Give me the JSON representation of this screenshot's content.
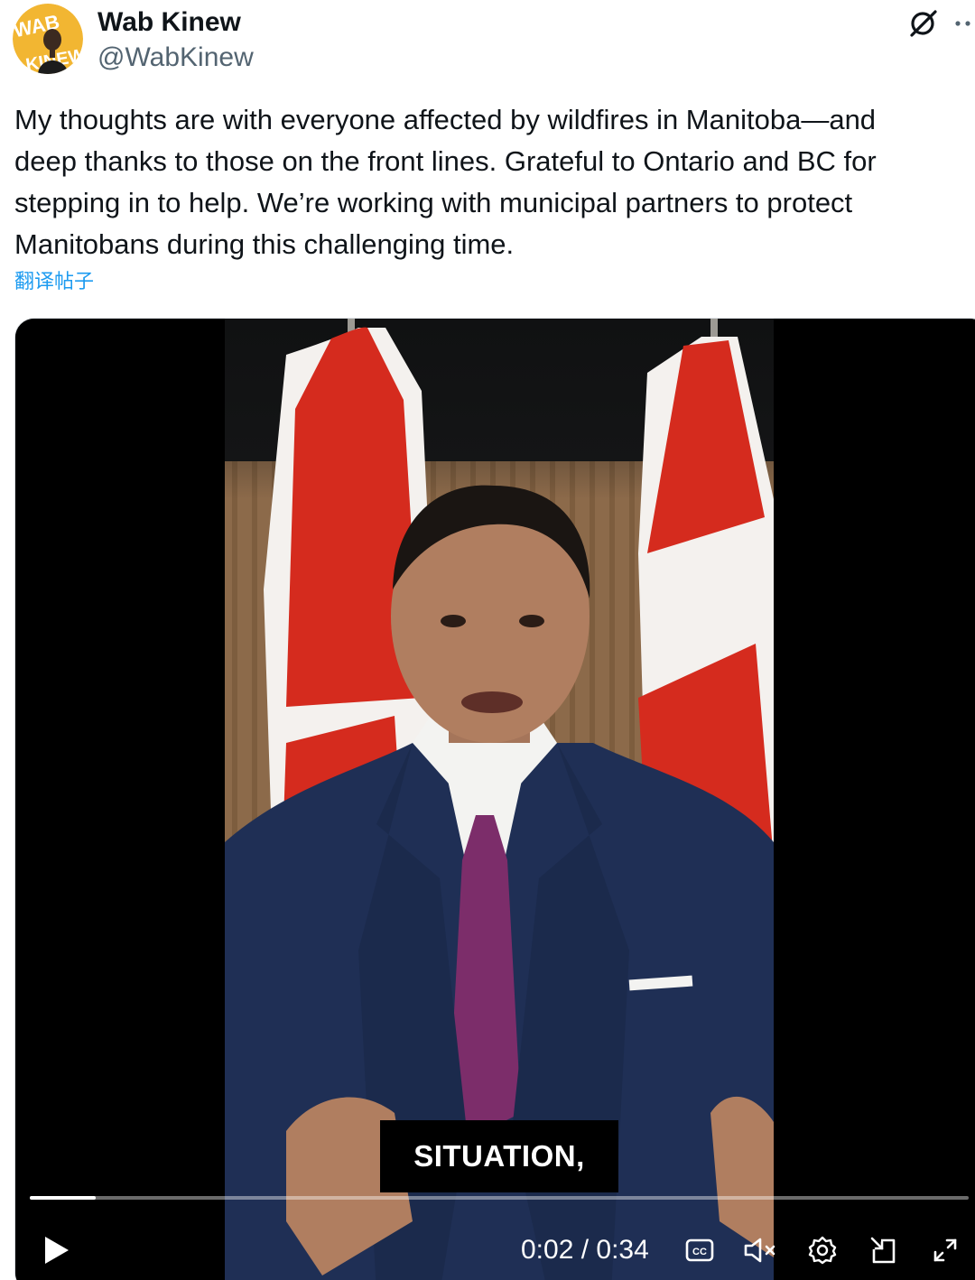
{
  "author": {
    "display_name": "Wab Kinew",
    "handle": "@WabKinew",
    "avatar_text": "WAB KINEW"
  },
  "header_icons": {
    "grok": "grok-icon",
    "more": "more-icon"
  },
  "tweet": {
    "text": "My thoughts are with everyone affected by wildfires in Manitoba—and\ndeep thanks to those on the front lines. Grateful to Ontario and BC for\nstepping in to help. We’re working with municipal partners to protect\nManitobans during this challenging time.",
    "translate_label": "翻译帖子"
  },
  "video": {
    "caption": "SITUATION,",
    "current_time": "0:02",
    "separator": "/",
    "duration": "0:34",
    "time_readout": "0:02 / 0:34",
    "progress_fraction": 0.07,
    "cc_label": "CC",
    "icons": {
      "play": "play-icon",
      "captions": "captions-icon",
      "mute": "volume-muted-icon",
      "settings": "settings-icon",
      "pip": "picture-in-picture-icon",
      "fullscreen": "fullscreen-icon"
    },
    "colors": {
      "jacket": "#1f2f55",
      "tie": "#7c2d6a",
      "flag_red": "#d52b1e",
      "panel_wood": "#8c6a4a"
    }
  },
  "colors": {
    "text_primary": "#0f1419",
    "text_secondary": "#536471",
    "link": "#1d9bf0",
    "video_bg": "#000000",
    "avatar_yellow": "#f2b632"
  }
}
